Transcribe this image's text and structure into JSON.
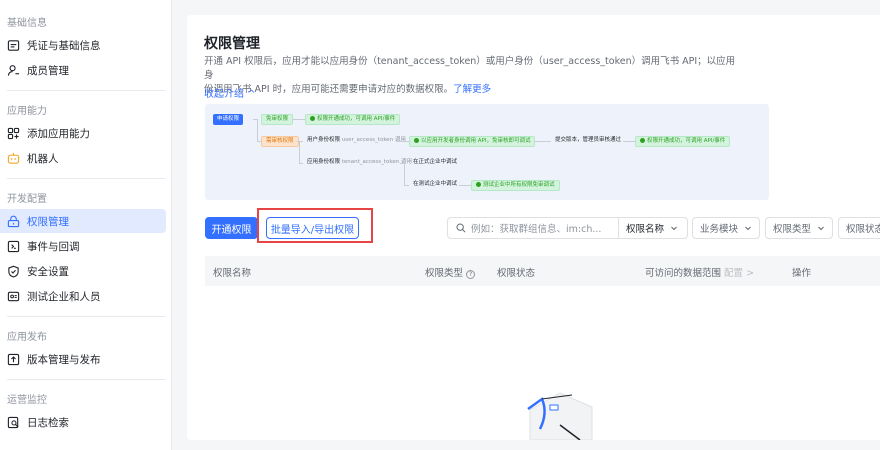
{
  "sidebar": {
    "sections": [
      {
        "title": "基础信息",
        "items": [
          {
            "label": "凭证与基础信息",
            "icon": "credential-icon"
          },
          {
            "label": "成员管理",
            "icon": "user-icon"
          }
        ]
      },
      {
        "title": "应用能力",
        "items": [
          {
            "label": "添加应用能力",
            "icon": "apps-icon"
          },
          {
            "label": "机器人",
            "icon": "bot-icon"
          }
        ]
      },
      {
        "title": "开发配置",
        "items": [
          {
            "label": "权限管理",
            "icon": "lock-icon",
            "active": true
          },
          {
            "label": "事件与回调",
            "icon": "event-icon"
          },
          {
            "label": "安全设置",
            "icon": "shield-icon"
          },
          {
            "label": "测试企业和人员",
            "icon": "test-icon"
          }
        ]
      },
      {
        "title": "应用发布",
        "items": [
          {
            "label": "版本管理与发布",
            "icon": "upload-icon"
          }
        ]
      },
      {
        "title": "运营监控",
        "items": [
          {
            "label": "日志检索",
            "icon": "log-search-icon"
          }
        ]
      }
    ]
  },
  "main": {
    "title": "权限管理",
    "desc_line1": "开通 API 权限后，应用才能以应用身份（tenant_access_token）或用户身份（user_access_token）调用飞书 API；以应用身",
    "desc_line2": "份调用飞书 API 时，应用可能还需要申请对应的数据权限。",
    "learn_more": "了解更多",
    "collapse": "收起介绍 ^",
    "diagram": {
      "apply": "申请权限",
      "free": "免审权限",
      "free_result": "权限开通成功，可调用 API/事件",
      "review": "需审核权限",
      "user_identity": "用户身份权限",
      "user_token": "user_access_token 调用",
      "user_tenant_call": "以应用开发者身份调用 API，免审核即可调试",
      "submit": "提交版本，管理员审核通过",
      "review_result": "权限开通成功，可调用 API/事件",
      "app_identity": "应用身份权限",
      "tenant_token": "tenant_access_token 调用",
      "formal": "在正式企业中调试",
      "test": "在测试企业中调试",
      "test_result": "测试企业中所有权限免审调试"
    },
    "toolbar": {
      "enable_btn": "开通权限",
      "batch_btn": "批量导入/导出权限",
      "search_placeholder": "例如：获取群组信息、im:ch...",
      "name_select": "权限名称",
      "biz_select": "业务模块",
      "type_select": "权限类型",
      "status_select": "权限状态"
    },
    "table": {
      "col_name": "权限名称",
      "col_type": "权限类型",
      "col_status": "权限状态",
      "col_scope": "可访问的数据范围",
      "col_scope_config": "配置 >",
      "col_action": "操作"
    }
  },
  "colors": {
    "accent": "#3370ff",
    "highlight": "#e54545",
    "active_bg": "#e1eaff"
  }
}
